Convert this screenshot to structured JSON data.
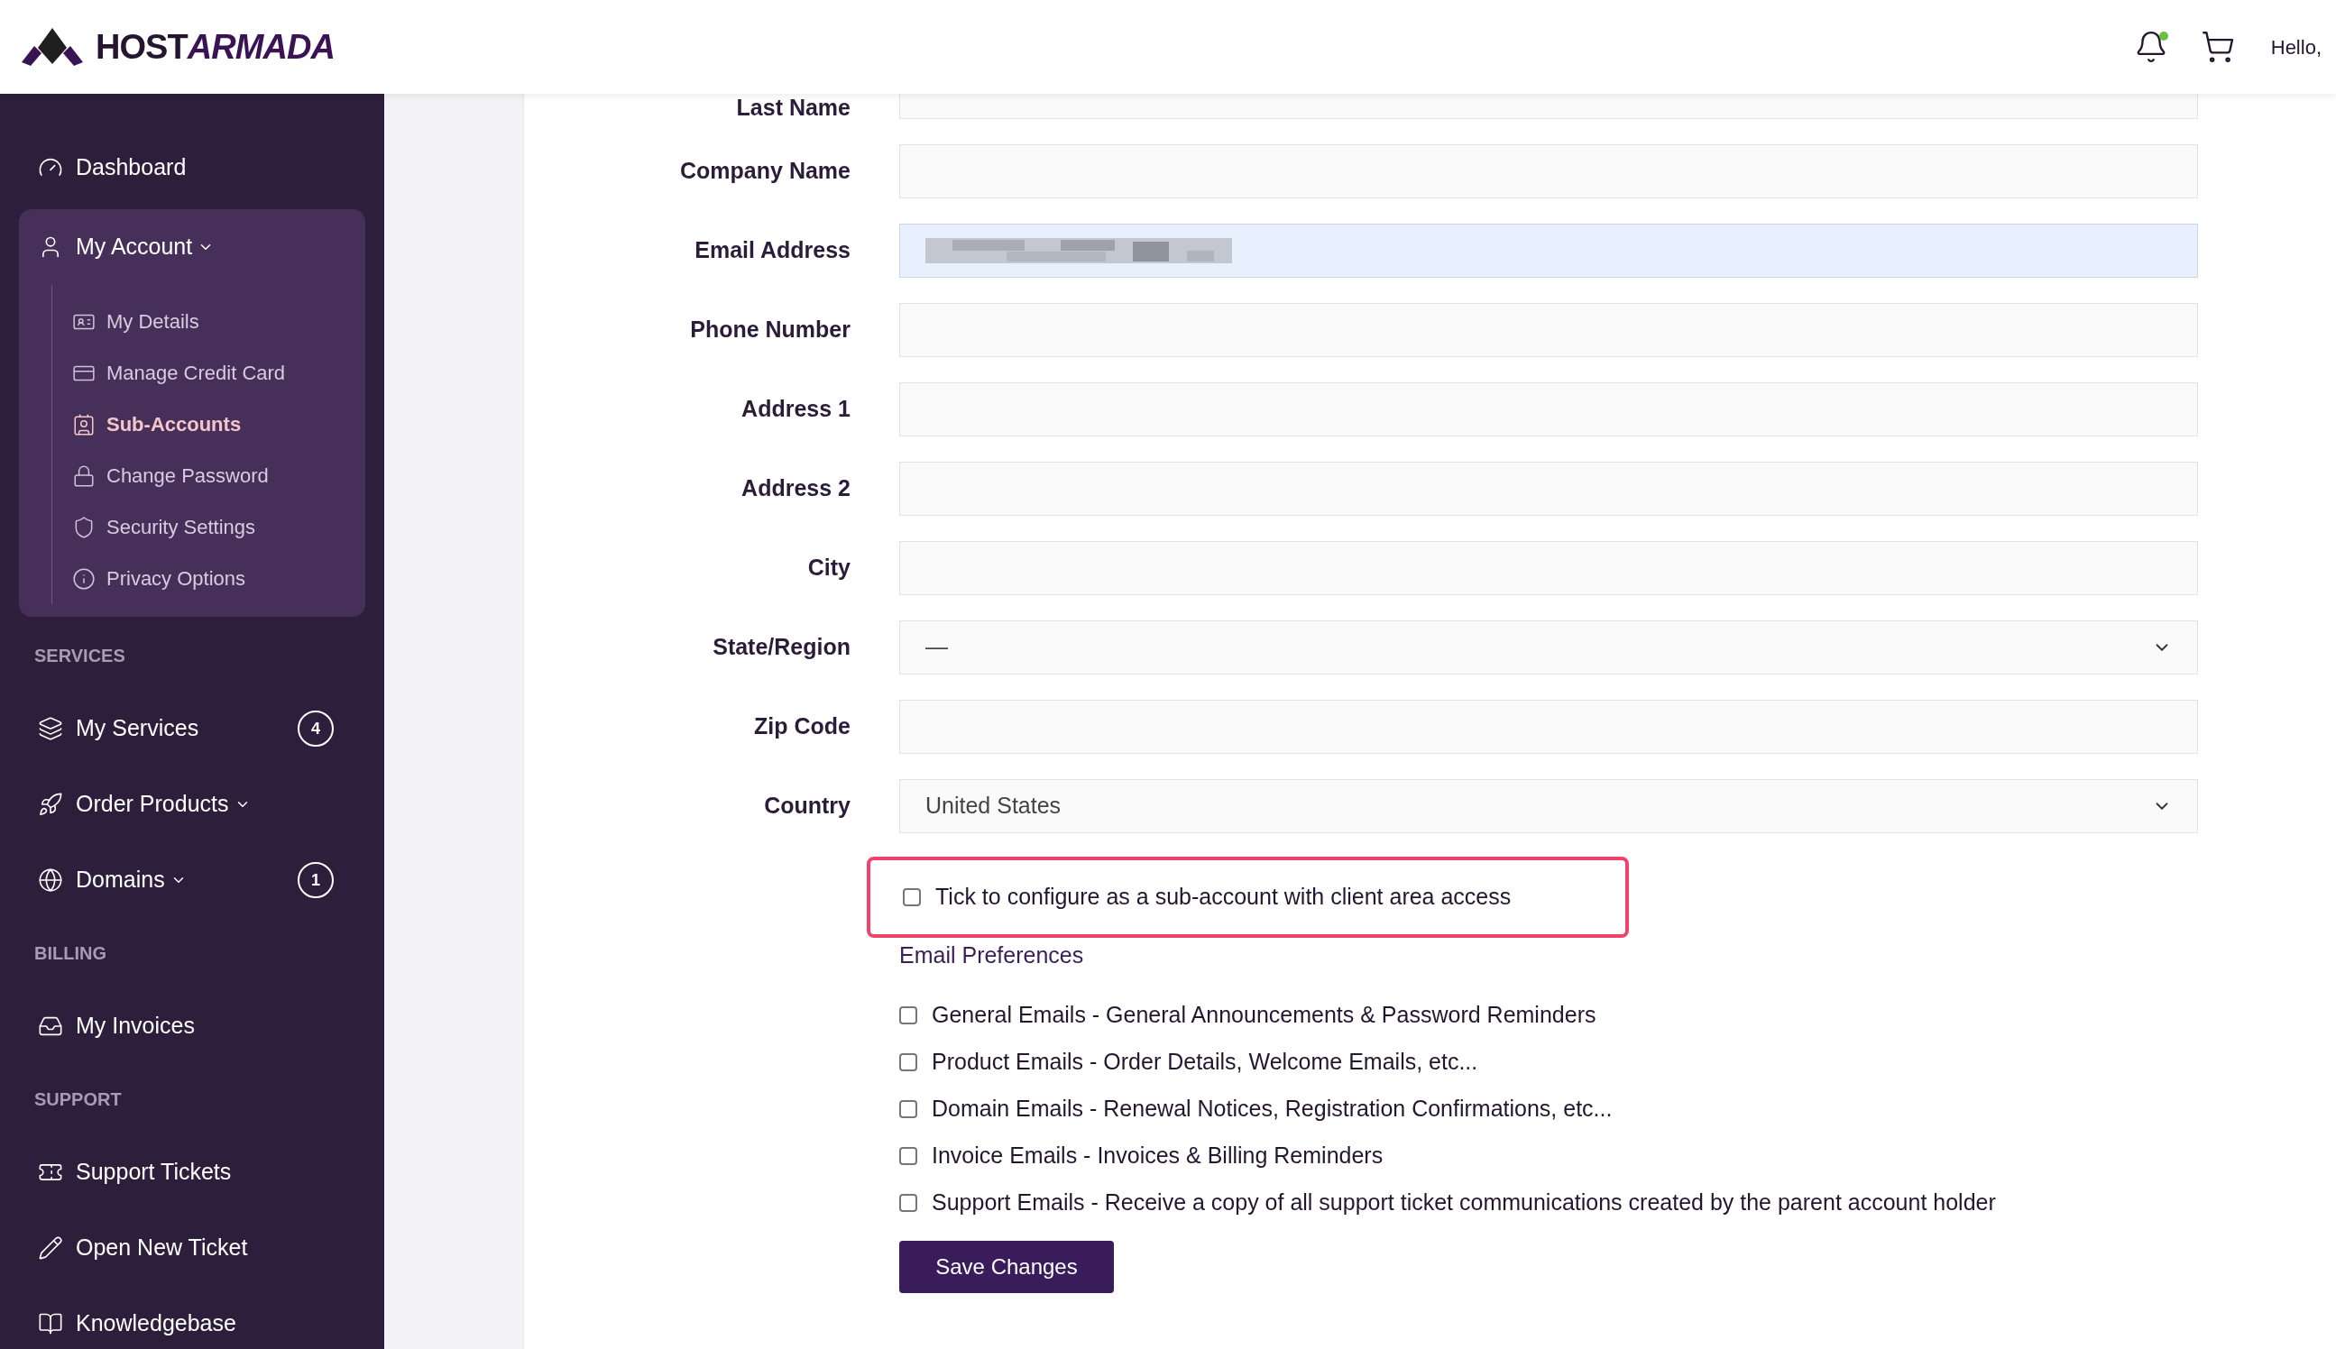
{
  "header": {
    "logo": {
      "first": "HOST",
      "second": "ARMADA"
    },
    "has_notification": true,
    "greeting": "Hello,"
  },
  "sidebar": {
    "items": [
      {
        "kind": "link",
        "label": "Dashboard"
      },
      {
        "kind": "group",
        "label": "My Account",
        "expanded": true,
        "children": [
          {
            "label": "My Details",
            "selected": false
          },
          {
            "label": "Manage Credit Card",
            "selected": false
          },
          {
            "label": "Sub-Accounts",
            "selected": true
          },
          {
            "label": "Change Password",
            "selected": false
          },
          {
            "label": "Security Settings",
            "selected": false
          },
          {
            "label": "Privacy Options",
            "selected": false
          }
        ]
      },
      {
        "kind": "section",
        "label": "SERVICES"
      },
      {
        "kind": "link",
        "label": "My Services",
        "badge": "4"
      },
      {
        "kind": "dropdown",
        "label": "Order Products",
        "expanded": false
      },
      {
        "kind": "dropdown",
        "label": "Domains",
        "expanded": false,
        "badge": "1"
      },
      {
        "kind": "section",
        "label": "BILLING"
      },
      {
        "kind": "link",
        "label": "My Invoices"
      },
      {
        "kind": "section",
        "label": "SUPPORT"
      },
      {
        "kind": "link",
        "label": "Support Tickets"
      },
      {
        "kind": "link",
        "label": "Open New Ticket"
      },
      {
        "kind": "link",
        "label": "Knowledgebase"
      }
    ]
  },
  "form": {
    "fields": [
      {
        "label": "Last Name",
        "kind": "text"
      },
      {
        "label": "Company Name",
        "kind": "text"
      },
      {
        "label": "Email Address",
        "kind": "text",
        "autofilled": true,
        "redacted": true
      },
      {
        "label": "Phone Number",
        "kind": "text"
      },
      {
        "label": "Address 1",
        "kind": "text"
      },
      {
        "label": "Address 2",
        "kind": "text"
      },
      {
        "label": "City",
        "kind": "text"
      },
      {
        "label": "State/Region",
        "kind": "select",
        "value": "—"
      },
      {
        "label": "Zip Code",
        "kind": "text"
      },
      {
        "label": "Country",
        "kind": "select",
        "value": "United States"
      }
    ],
    "sub_account": {
      "label": "Tick to configure as a sub-account with client area access",
      "checked": false,
      "highlighted": true
    },
    "email_preferences": {
      "title": "Email Preferences",
      "options": [
        {
          "label": "General Emails - General Announcements & Password Reminders",
          "checked": false
        },
        {
          "label": "Product Emails - Order Details, Welcome Emails, etc...",
          "checked": false
        },
        {
          "label": "Domain Emails - Renewal Notices, Registration Confirmations, etc...",
          "checked": false
        },
        {
          "label": "Invoice Emails - Invoices & Billing Reminders",
          "checked": false
        },
        {
          "label": "Support Emails - Receive a copy of all support ticket communications created by the parent account holder",
          "checked": false
        }
      ]
    },
    "save_button": "Save Changes"
  }
}
